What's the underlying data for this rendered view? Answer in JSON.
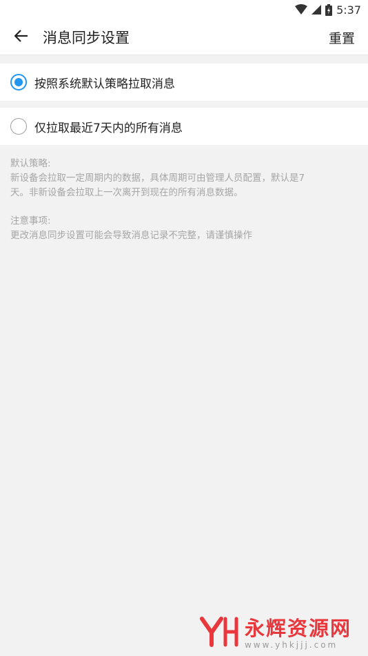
{
  "status_bar": {
    "time": "5:37",
    "icons": [
      "wifi-icon",
      "signal-icon",
      "battery-icon"
    ]
  },
  "header": {
    "title": "消息同步设置",
    "reset_label": "重置",
    "back_icon": "arrow-left-icon"
  },
  "options": [
    {
      "label": "按照系统默认策略拉取消息",
      "checked": true
    },
    {
      "label": "仅拉取最近7天内的所有消息",
      "checked": false
    }
  ],
  "notes": {
    "default_heading": "默认策略:",
    "default_line1": "新设备会拉取一定周期内的数据，具体周期可由管理人员配置，默认是7",
    "default_line2": "天。非新设备会拉取上一次离开到现在的所有消息数据。",
    "caution_heading": "注意事项:",
    "caution_line1": "更改消息同步设置可能会导致消息记录不完整，请谨慎操作"
  },
  "watermark": {
    "title": "永辉资源网",
    "url": "www.yhkjjj.com"
  },
  "colors": {
    "accent": "#2196f3",
    "background": "#f2f2f2",
    "watermark": "#e8383d",
    "note_text": "#a5a5a5"
  }
}
